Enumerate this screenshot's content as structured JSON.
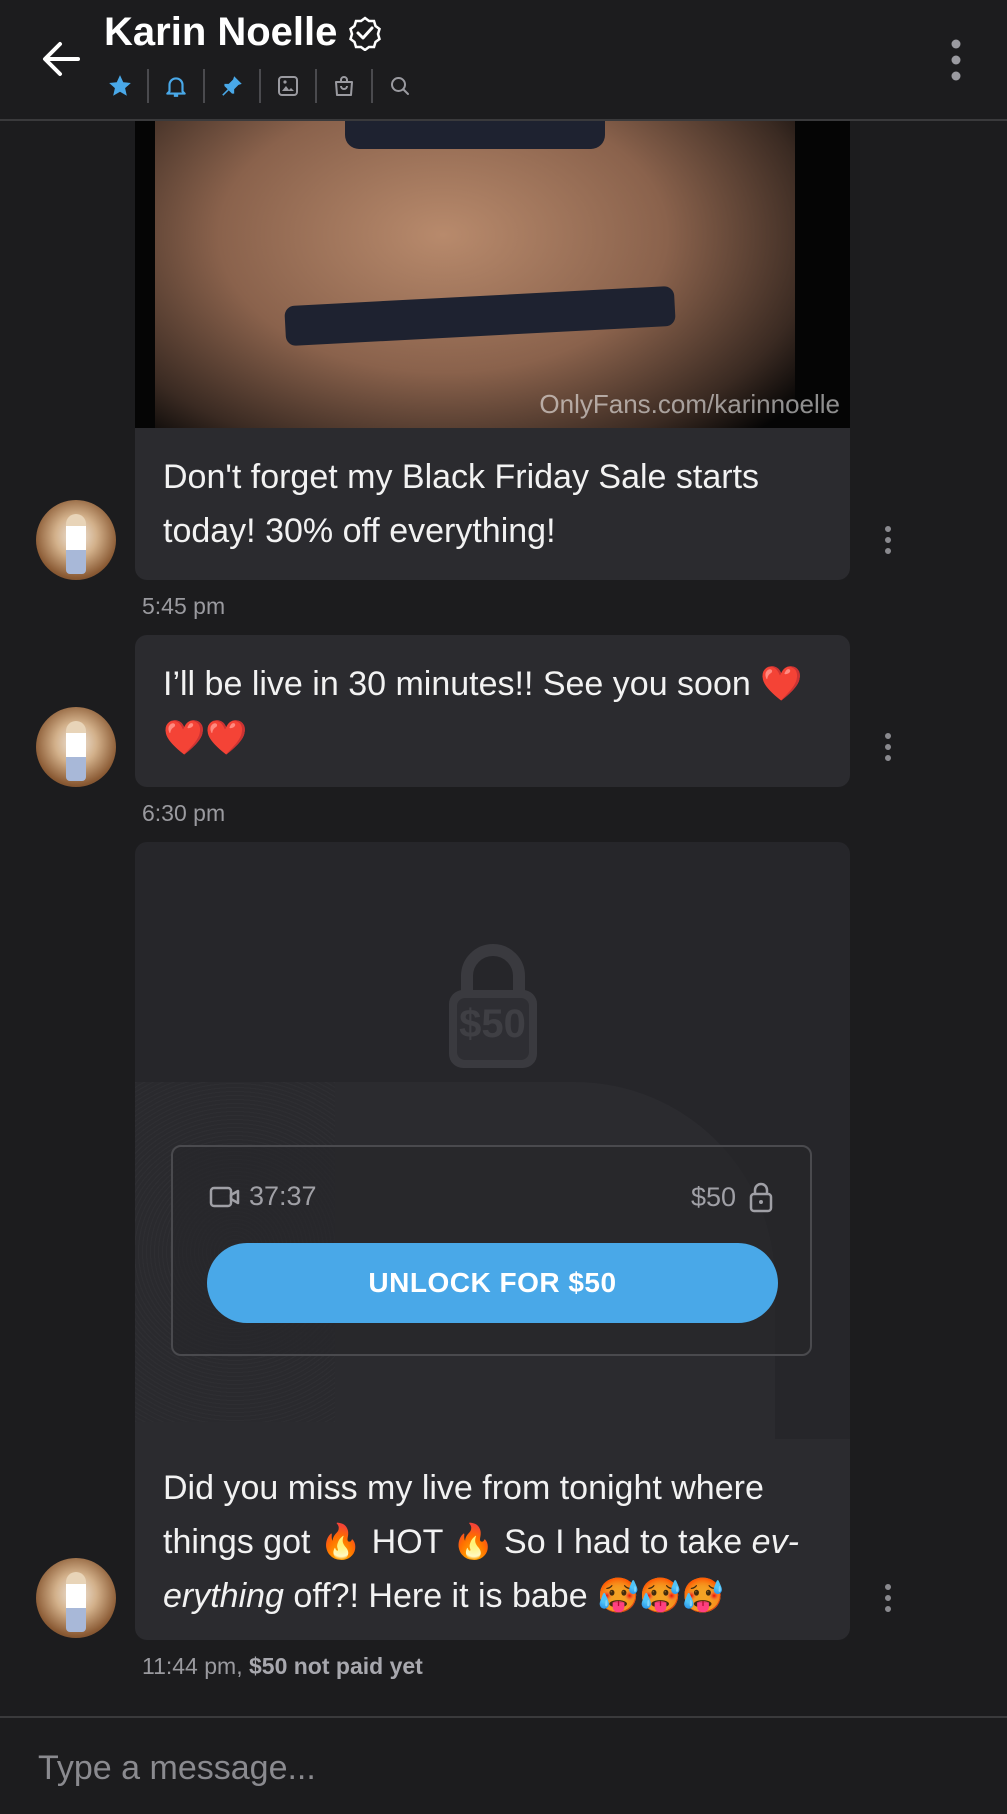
{
  "header": {
    "title": "Karin Noelle",
    "colors": {
      "accent": "#49a8e8",
      "icon": "#9a9aa0"
    },
    "icons": [
      "star-icon",
      "bell-icon",
      "pin-icon",
      "image-icon",
      "bag-icon",
      "search-icon"
    ]
  },
  "messages": [
    {
      "media_watermark": "OnlyFans.com/karinnoelle",
      "text": "Don't forget my Black Friday Sale starts today! 30% off everything!",
      "time": "5:45 pm"
    },
    {
      "text": "I’ll be live in 30 minutes!! See you soon ❤️❤️❤️",
      "time": "6:30 pm"
    },
    {
      "locked": {
        "price_overlay": "$50",
        "duration": "37:37",
        "price": "$50",
        "unlock_label": "UNLOCK FOR $50"
      },
      "text_before_italic": "Did you miss my live from tonight where things got 🔥 HOT 🔥 So I had to take ",
      "text_italic": "ev-erything",
      "text_after_italic": " off?! Here it is babe 🥵🥵🥵",
      "time": "11:44 pm,",
      "status": "$50 not paid yet"
    }
  ],
  "composer": {
    "placeholder": "Type a message..."
  }
}
